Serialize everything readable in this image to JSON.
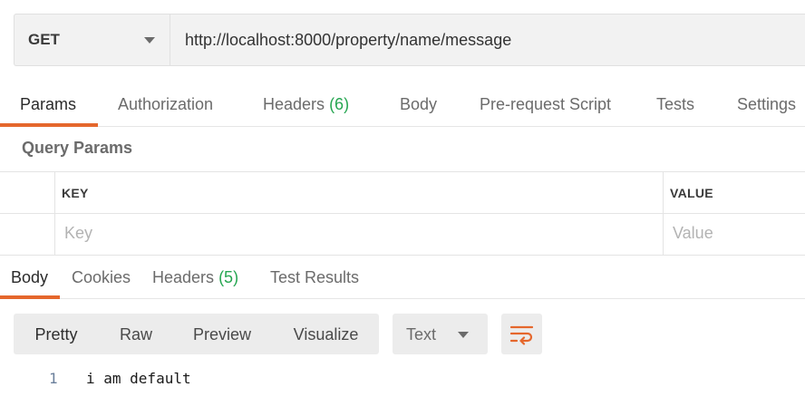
{
  "request": {
    "method": "GET",
    "url": "http://localhost:8000/property/name/message"
  },
  "request_tabs": [
    {
      "label": "Params",
      "count": ""
    },
    {
      "label": "Authorization",
      "count": ""
    },
    {
      "label": "Headers",
      "count": "(6)"
    },
    {
      "label": "Body",
      "count": ""
    },
    {
      "label": "Pre-request Script",
      "count": ""
    },
    {
      "label": "Tests",
      "count": ""
    },
    {
      "label": "Settings",
      "count": ""
    }
  ],
  "query_params": {
    "title": "Query Params",
    "columns": [
      "KEY",
      "VALUE"
    ],
    "key_placeholder": "Key",
    "value_placeholder": "Value"
  },
  "response_tabs": [
    {
      "label": "Body",
      "count": ""
    },
    {
      "label": "Cookies",
      "count": ""
    },
    {
      "label": "Headers",
      "count": "(5)"
    },
    {
      "label": "Test Results",
      "count": ""
    }
  ],
  "view_modes": [
    "Pretty",
    "Raw",
    "Preview",
    "Visualize"
  ],
  "format_select": "Text",
  "icons": {
    "method_dropdown": "chevron-down-icon",
    "format_dropdown": "chevron-down-icon",
    "wrap": "wrap-lines-icon"
  },
  "colors": {
    "accent": "#e5672c",
    "count": "#26a651"
  },
  "response_body": {
    "lines": [
      {
        "number": "1",
        "text": "i am default"
      }
    ]
  }
}
